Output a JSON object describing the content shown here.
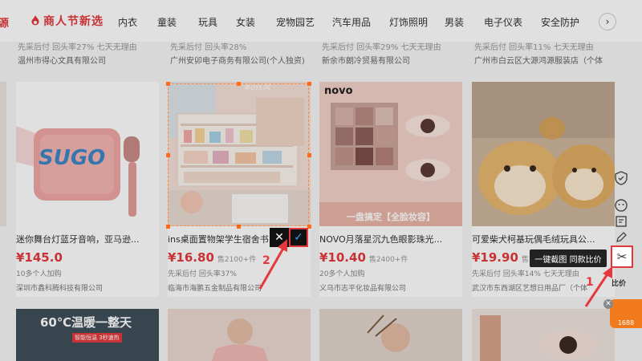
{
  "categories": {
    "prev_partial": "源",
    "festival": "商人节新选",
    "items": [
      "内衣",
      "童装",
      "玩具",
      "女装",
      "宠物园艺",
      "汽车用品",
      "灯饰照明",
      "男装",
      "电子仪表",
      "安全防护"
    ],
    "next_icon": "chevron-right-icon"
  },
  "row1": [
    {
      "tags": "先采后付 回头率27% 七天无理由",
      "shop": "温州市得心文具有限公司"
    },
    {
      "tags": "先采后付 回头率28%",
      "shop": "广州安卯电子商务有限公司(个人独资)"
    },
    {
      "tags": "先采后付 回头率29% 七天无理由",
      "shop": "新余市朗冷贸易有限公司"
    },
    {
      "tags": "先采后付 回头率11% 七天无理由",
      "shop": "广州市白云区大源鸿源服装店（个体"
    }
  ],
  "products": [
    {
      "title": "迷你舞台灯蓝牙音响，亚马逊...",
      "price": "¥145.0",
      "sold": "",
      "meta": "10多个人加购",
      "shop": "深圳市鑫科腾科技有限公司",
      "img_text": "SUGO"
    },
    {
      "title": "ins桌面置物架学生宿舍书...",
      "price": "¥16.80",
      "sold": "售2100+件",
      "meta": "先采后付 回头率37%",
      "shop": "临海市海鹏五金制品有限公司",
      "img_text": "#ins风"
    },
    {
      "title": "NOVO月落星沉九色眼影珠光...",
      "price": "¥10.40",
      "sold": "售2400+件",
      "meta": "20多个人加购",
      "shop": "义乌市志平化妆品有限公司",
      "img_text": "novo",
      "img_caption": "一盘搞定【全脸妆容】"
    },
    {
      "title": "可爱柴犬柯基玩偶毛绒玩具公...",
      "price": "¥19.90",
      "sold": "售3万+件",
      "meta": "先采后付 回头率14% 七天无理由",
      "shop": "武汉市东西湖区艺想日用品厂（个体"
    }
  ],
  "row3": [
    {
      "banner": "60℃温暖一整天",
      "sub": "智能恒温 3秒速热"
    }
  ],
  "screenshot_tool": {
    "tooltip": "一键截图 同款比价",
    "compare_label": "比价",
    "logo": "1688",
    "close_icon": "close-icon",
    "cancel_icon": "close-icon",
    "confirm_icon": "checkmark-icon"
  },
  "annotations": {
    "step1": "1",
    "step2": "2"
  },
  "colors": {
    "accent_red": "#e4393c",
    "handle_orange": "#ff6a1a",
    "logo_orange": "#f07a1c"
  }
}
